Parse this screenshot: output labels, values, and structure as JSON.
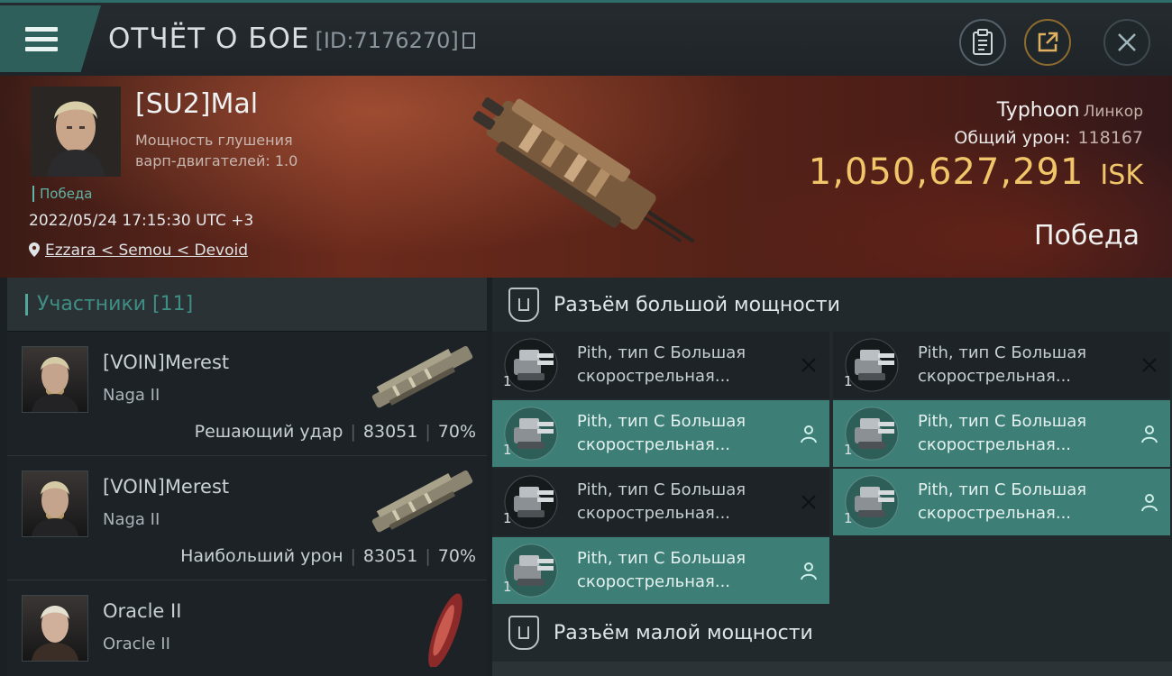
{
  "header": {
    "title": "ОТЧЁТ О БОЕ",
    "id_text": "[ID:7176270]"
  },
  "victim": {
    "name": "[SU2]Mal",
    "warp_line1": "Мощность глушения",
    "warp_line2": "варп-двигателей: 1.0",
    "status": "Победа",
    "datetime": "2022/05/24 17:15:30 UTC +3",
    "location": "Ezzara < Semou < Devoid"
  },
  "ship": {
    "name": "Typhoon",
    "class": "Линкор",
    "damage_label": "Общий урон:",
    "damage_value": "118167",
    "isk_value": "1,050,627,291",
    "isk_unit": "ISK",
    "outcome": "Победа"
  },
  "participants": {
    "header": "Участники [11]",
    "rows": [
      {
        "name": "[VOIN]Merest",
        "ship": "Naga II",
        "role": "Решающий удар",
        "damage": "83051",
        "percent": "70%"
      },
      {
        "name": "[VOIN]Merest",
        "ship": "Naga II",
        "role": "Наибольший урон",
        "damage": "83051",
        "percent": "70%"
      },
      {
        "name": "Oracle II",
        "ship": "Oracle II"
      }
    ]
  },
  "high_slots": {
    "title": "Разъём большой мощности",
    "modules": [
      {
        "line1": "Pith, тип C Большая",
        "line2": "скорострельная...",
        "qty": "1",
        "state": "destroyed"
      },
      {
        "line1": "Pith, тип C Большая",
        "line2": "скорострельная...",
        "qty": "1",
        "state": "destroyed"
      },
      {
        "line1": "Pith, тип C Большая",
        "line2": "скорострельная...",
        "qty": "1",
        "state": "dropped"
      },
      {
        "line1": "Pith, тип C Большая",
        "line2": "скорострельная...",
        "qty": "1",
        "state": "dropped"
      },
      {
        "line1": "Pith, тип C Большая",
        "line2": "скорострельная...",
        "qty": "1",
        "state": "destroyed"
      },
      {
        "line1": "Pith, тип C Большая",
        "line2": "скорострельная...",
        "qty": "1",
        "state": "dropped"
      },
      {
        "line1": "Pith, тип C Большая",
        "line2": "скорострельная...",
        "qty": "1",
        "state": "dropped"
      }
    ]
  },
  "low_slots": {
    "title": "Разъём малой мощности"
  },
  "colors": {
    "accent": "#3d7f76",
    "isk": "#f1c56a",
    "hero_red": "#6b2a1c"
  },
  "icons": {
    "menu": "hamburger-icon",
    "clipboard": "clipboard-icon",
    "share": "share-icon",
    "close": "close-icon",
    "pin": "map-pin-icon",
    "slot": "shield-slot-icon",
    "destroyed": "x-icon",
    "dropped": "person-icon"
  }
}
